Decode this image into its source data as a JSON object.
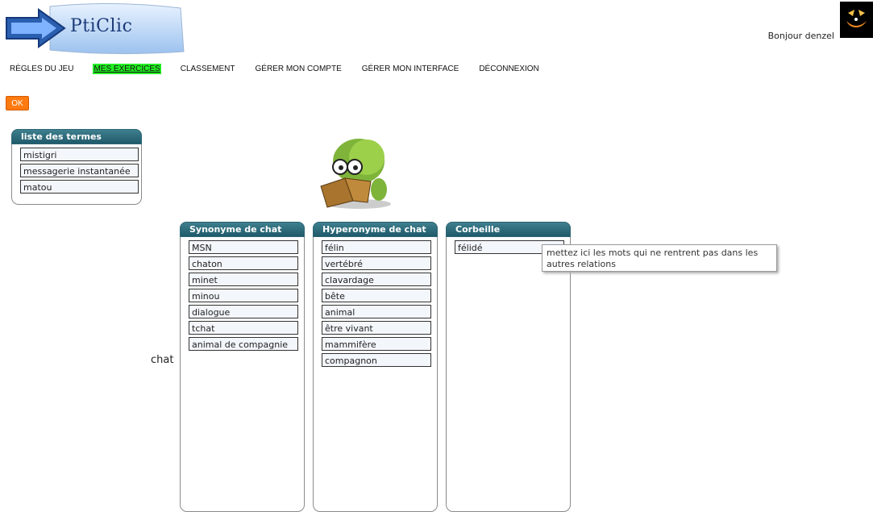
{
  "logo": {
    "text": "PtiClic"
  },
  "header": {
    "greeting": "Bonjour denzel"
  },
  "nav": {
    "items": [
      {
        "label": "RÈGLES DU JEU"
      },
      {
        "label": "MES EXERCICES"
      },
      {
        "label": "CLASSEMENT"
      },
      {
        "label": "GÉRER MON COMPTE"
      },
      {
        "label": "GÉRER MON INTERFACE"
      },
      {
        "label": "DÉCONNEXION"
      }
    ]
  },
  "ok_label": "OK",
  "terms_box": {
    "title": "liste des termes",
    "items": [
      "mistigri",
      "messagerie instantanée",
      "matou"
    ]
  },
  "center_word": "chat",
  "columns": [
    {
      "title": "Synonyme de chat",
      "items": [
        "MSN",
        "chaton",
        "minet",
        "minou",
        "dialogue",
        "tchat",
        "animal de compagnie"
      ]
    },
    {
      "title": "Hyperonyme de chat",
      "items": [
        "félin",
        "vertébré",
        "clavardage",
        "bête",
        "animal",
        "être vivant",
        "mammifère",
        "compagnon"
      ]
    },
    {
      "title": "Corbeille",
      "items": [
        "félidé"
      ]
    }
  ],
  "tooltip": "mettez ici les mots qui ne rentrent pas dans les autres relations",
  "colors": {
    "accent_header": "#2c6676",
    "active_nav": "#22ee22",
    "ok_button": "#ff7a10"
  }
}
